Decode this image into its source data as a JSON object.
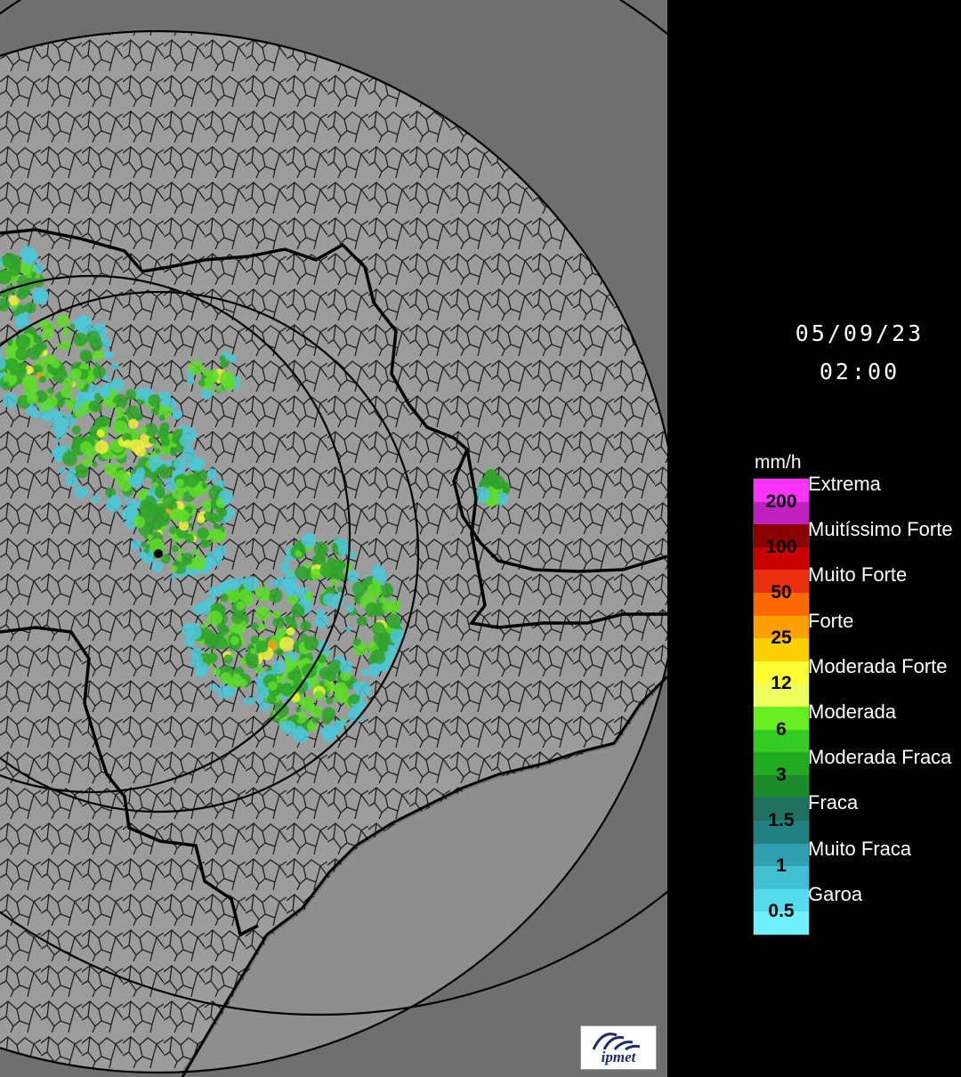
{
  "timestamp": {
    "date": "05/09/23",
    "time": "02:00"
  },
  "legend": {
    "unit": "mm/h",
    "ticks": [
      "200",
      "100",
      "50",
      "25",
      "12",
      "6",
      "3",
      "1.5",
      "1",
      "0.5"
    ],
    "classes": [
      "Extrema",
      "Muitíssimo Forte",
      "Muito Forte",
      "Forte",
      "Moderada Forte",
      "Moderada",
      "Moderada Fraca",
      "Fraca",
      "Muito Fraca",
      "Garoa"
    ],
    "colors": [
      "#ff33ff",
      "#c020c0",
      "#8b0000",
      "#c80000",
      "#e83010",
      "#ff6a00",
      "#ffa000",
      "#ffd000",
      "#ffff33",
      "#f0ff60",
      "#66ee22",
      "#33cc22",
      "#22aa22",
      "#1a8a2a",
      "#207060",
      "#208080",
      "#30a0b0",
      "#40c0d0",
      "#55dcec",
      "#70f0ff"
    ]
  },
  "logo": {
    "text": "ipmet"
  },
  "map": {
    "colors": {
      "outside": "#6f6f6f",
      "coverage": "#9c9c9c",
      "border": "#000000",
      "sea": "#777777"
    }
  }
}
